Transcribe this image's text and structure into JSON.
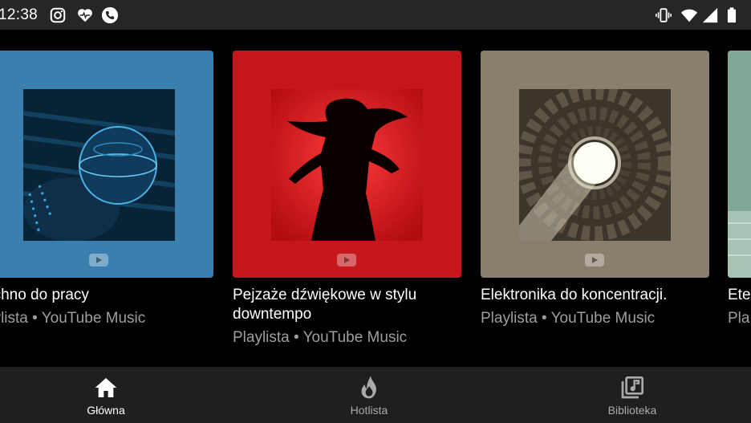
{
  "status_bar": {
    "time": "12:38",
    "left_icons": [
      "instagram-icon",
      "heart-pulse-icon",
      "phone-icon"
    ],
    "right_icons": [
      "vibrate-icon",
      "wifi-icon",
      "signal-icon",
      "battery-icon"
    ]
  },
  "carousel": {
    "cards": [
      {
        "title": "echno do pracy",
        "subtitle": "aylista • YouTube Music",
        "color": "#3b7fae"
      },
      {
        "title": "Pejzaże dźwiękowe w stylu downtempo",
        "subtitle": "Playlista • YouTube Music",
        "color": "#c4161c"
      },
      {
        "title": "Elektronika do koncentracji.",
        "subtitle": "Playlista • YouTube Music",
        "color": "#8a7f6c"
      },
      {
        "title": "Ete",
        "subtitle": "Pla",
        "color": "#8fb39f"
      }
    ]
  },
  "bottom_nav": {
    "items": [
      {
        "label": "Główna",
        "icon": "home-icon",
        "active": true
      },
      {
        "label": "Hotlista",
        "icon": "flame-icon",
        "active": false
      },
      {
        "label": "Biblioteka",
        "icon": "library-music-icon",
        "active": false
      }
    ]
  },
  "colors": {
    "active": "#ffffff",
    "inactive": "#aaaaaa",
    "nav_bg": "#1f1f1f",
    "status_bg": "#262626"
  }
}
